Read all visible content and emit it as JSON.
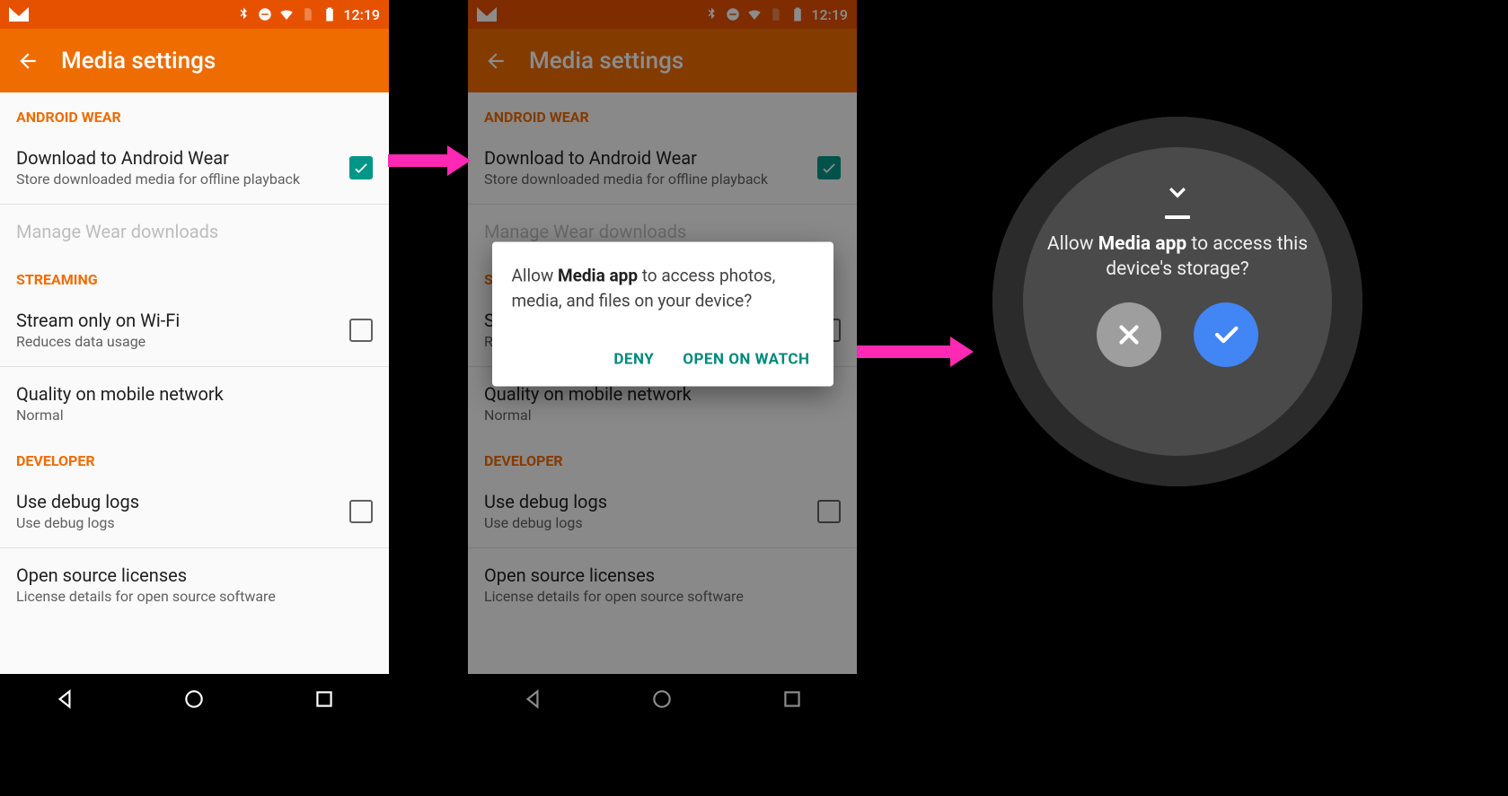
{
  "statusbar": {
    "time": "12:19"
  },
  "appbar": {
    "title": "Media settings"
  },
  "sections": {
    "wear": {
      "header": "ANDROID WEAR",
      "download": {
        "title": "Download to Android Wear",
        "sub": "Store downloaded media for offline playback"
      },
      "manage": {
        "title": "Manage Wear downloads"
      }
    },
    "streaming": {
      "header": "STREAMING",
      "wifi": {
        "title": "Stream only on Wi-Fi",
        "sub": "Reduces data usage"
      },
      "quality": {
        "title": "Quality on mobile network",
        "sub": "Normal"
      }
    },
    "dev": {
      "header": "DEVELOPER",
      "debug": {
        "title": "Use debug logs",
        "sub": "Use debug logs"
      },
      "oss": {
        "title": "Open source licenses",
        "sub": "License details for open source software"
      }
    }
  },
  "dialog": {
    "prefix": "Allow ",
    "app": "Media app",
    "suffix": " to access photos, media, and files on your device?",
    "deny": "DENY",
    "open": "OPEN ON WATCH"
  },
  "watch": {
    "prefix": "Allow ",
    "app": "Media app",
    "suffix": "  to access this device's storage?"
  }
}
